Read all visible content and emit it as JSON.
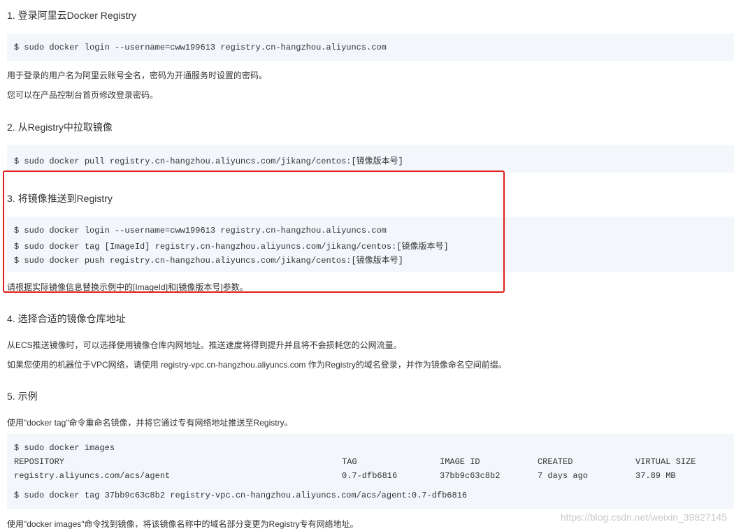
{
  "sections": {
    "s1": {
      "heading": "1. 登录阿里云Docker Registry",
      "code": [
        "$ sudo docker login --username=cww199613 registry.cn-hangzhou.aliyuncs.com"
      ],
      "paras": [
        "用于登录的用户名为阿里云账号全名，密码为开通服务时设置的密码。",
        "您可以在产品控制台首页修改登录密码。"
      ]
    },
    "s2": {
      "heading": "2. 从Registry中拉取镜像",
      "code": [
        "$ sudo docker pull registry.cn-hangzhou.aliyuncs.com/jikang/centos:[镜像版本号]"
      ]
    },
    "s3": {
      "heading": "3. 将镜像推送到Registry",
      "code": [
        "$ sudo docker login --username=cww199613 registry.cn-hangzhou.aliyuncs.com",
        "$ sudo docker tag [ImageId] registry.cn-hangzhou.aliyuncs.com/jikang/centos:[镜像版本号]",
        "$ sudo docker push registry.cn-hangzhou.aliyuncs.com/jikang/centos:[镜像版本号]"
      ],
      "paras": [
        "请根据实际镜像信息替换示例中的[ImageId]和[镜像版本号]参数。"
      ]
    },
    "s4": {
      "heading": "4. 选择合适的镜像仓库地址",
      "paras": [
        "从ECS推送镜像时，可以选择使用镜像仓库内网地址。推送速度将得到提升并且将不会损耗您的公网流量。",
        "如果您使用的机器位于VPC网络，请使用 registry-vpc.cn-hangzhou.aliyuncs.com 作为Registry的域名登录，并作为镜像命名空间前缀。"
      ]
    },
    "s5": {
      "heading": "5. 示例",
      "intro": "使用\"docker tag\"命令重命名镜像，并将它通过专有网络地址推送至Registry。",
      "code": {
        "cmd1": "$ sudo docker images",
        "headers": [
          "REPOSITORY",
          "TAG",
          "IMAGE ID",
          "CREATED",
          "VIRTUAL SIZE"
        ],
        "row": [
          "registry.aliyuncs.com/acs/agent",
          "0.7-dfb6816",
          "37bb9c63c8b2",
          "7 days ago",
          "37.89 MB"
        ],
        "cmd2": "$ sudo docker tag 37bb9c63c8b2 registry-vpc.cn-hangzhou.aliyuncs.com/acs/agent:0.7-dfb6816"
      },
      "outro": "使用\"docker images\"命令找到镜像，将该镜像名称中的域名部分变更为Registry专有网络地址。"
    }
  },
  "watermark": "https://blog.csdn.net/weixin_39827145",
  "colors": {
    "code_bg": "#f3f6fb",
    "highlight_border": "#e0201c",
    "text": "#333333"
  }
}
